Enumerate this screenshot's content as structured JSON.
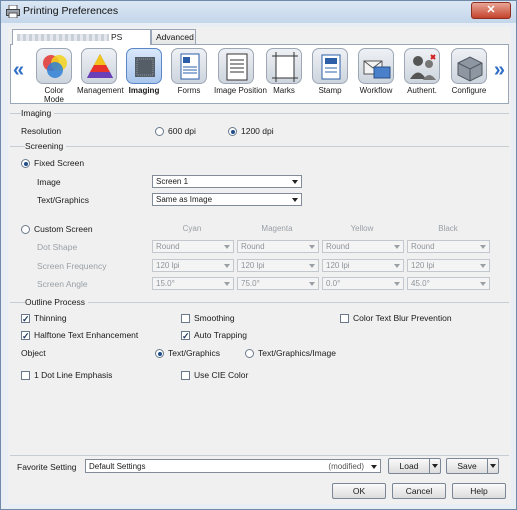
{
  "window": {
    "title": "Printing Preferences",
    "close_glyph": "✕"
  },
  "tabs": [
    {
      "label": "PS",
      "active": true
    },
    {
      "label": "Advanced",
      "active": false
    }
  ],
  "ribbon": {
    "prev_glyph": "«",
    "next_glyph": "»",
    "items": [
      {
        "label": "Color\nMode",
        "icon": "color-mode-icon"
      },
      {
        "label": "Management",
        "icon": "management-icon"
      },
      {
        "label": "Imaging",
        "icon": "imaging-icon",
        "selected": true
      },
      {
        "label": "Forms",
        "icon": "forms-icon"
      },
      {
        "label": "Image Position",
        "icon": "image-position-icon"
      },
      {
        "label": "Marks",
        "icon": "marks-icon"
      },
      {
        "label": "Stamp",
        "icon": "stamp-icon"
      },
      {
        "label": "Workflow",
        "icon": "workflow-icon"
      },
      {
        "label": "Authent.",
        "icon": "authentication-icon"
      },
      {
        "label": "Configure",
        "icon": "configure-icon"
      }
    ]
  },
  "imaging": {
    "section": "Imaging",
    "resolution_label": "Resolution",
    "res_600": "600 dpi",
    "res_1200": "1200 dpi",
    "selected_resolution": "1200 dpi"
  },
  "screening": {
    "section": "Screening",
    "fixed_label": "Fixed Screen",
    "image_label": "Image",
    "image_value": "Screen 1",
    "textgraphics_label": "Text/Graphics",
    "textgraphics_value": "Same as Image",
    "custom_label": "Custom Screen",
    "columns": [
      "Cyan",
      "Magenta",
      "Yellow",
      "Black"
    ],
    "rows": [
      {
        "label": "Dot Shape",
        "values": [
          "Round",
          "Round",
          "Round",
          "Round"
        ]
      },
      {
        "label": "Screen Frequency",
        "values": [
          "120 lpi",
          "120 lpi",
          "120 lpi",
          "120 lpi"
        ]
      },
      {
        "label": "Screen Angle",
        "values": [
          "15.0°",
          "75.0°",
          "0.0°",
          "45.0°"
        ]
      }
    ]
  },
  "outline": {
    "section": "Outline Process",
    "thinning": "Thinning",
    "smoothing": "Smoothing",
    "color_blur": "Color Text Blur Prevention",
    "halftone": "Halftone Text Enhancement",
    "auto_trapping": "Auto Trapping",
    "object_label": "Object",
    "obj_tg": "Text/Graphics",
    "obj_tgi": "Text/Graphics/Image",
    "dot_line": "1 Dot Line Emphasis",
    "cie": "Use CIE Color"
  },
  "favorite": {
    "label": "Favorite Setting",
    "value": "Default Settings",
    "modified": "(modified)",
    "load": "Load",
    "save": "Save"
  },
  "footer": {
    "ok": "OK",
    "cancel": "Cancel",
    "help": "Help"
  }
}
